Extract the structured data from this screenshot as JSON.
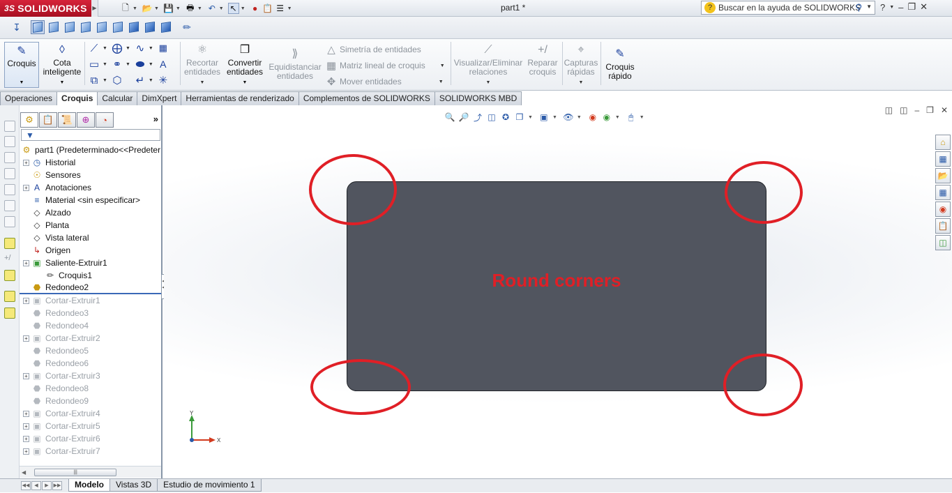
{
  "app": {
    "logo_ds": "3S",
    "logo_name": "SOLIDWORKS",
    "document_title": "part1 *"
  },
  "help": {
    "search_placeholder": "Buscar en la ayuda de SOLIDWORKS"
  },
  "command_manager": {
    "croquis": "Croquis",
    "cota_line1": "Cota",
    "cota_line2": "inteligente",
    "recortar_1": "Recortar",
    "recortar_2": "entidades",
    "convertir_1": "Convertir",
    "convertir_2": "entidades",
    "equidistanciar_1": "Equidistanciar",
    "equidistanciar_2": "entidades",
    "simetria": "Simetría de entidades",
    "matriz": "Matriz lineal de croquis",
    "mover": "Mover entidades",
    "visualizar_1": "Visualizar/Eliminar",
    "visualizar_2": "relaciones",
    "reparar_1": "Reparar",
    "reparar_2": "croquis",
    "capturas_1": "Capturas",
    "capturas_2": "rápidas",
    "croquis_rapido_1": "Croquis",
    "croquis_rapido_2": "rápido"
  },
  "tabs": [
    "Operaciones",
    "Croquis",
    "Calcular",
    "DimXpert",
    "Herramientas de renderizado",
    "Complementos de SOLIDWORKS",
    "SOLIDWORKS MBD"
  ],
  "active_tab": "Croquis",
  "feature_tree": [
    {
      "label": "part1  (Predeterminado<<Predeter",
      "icon": "part-icon",
      "level": 0,
      "expand": false,
      "state": "normal"
    },
    {
      "label": "Historial",
      "icon": "history-icon",
      "level": 1,
      "expand": true,
      "state": "normal"
    },
    {
      "label": "Sensores",
      "icon": "sensor-icon",
      "level": 1,
      "expand": false,
      "state": "normal"
    },
    {
      "label": "Anotaciones",
      "icon": "annotation-icon",
      "level": 1,
      "expand": true,
      "state": "normal"
    },
    {
      "label": "Material <sin especificar>",
      "icon": "material-icon",
      "level": 1,
      "expand": false,
      "state": "normal"
    },
    {
      "label": "Alzado",
      "icon": "plane-icon",
      "level": 1,
      "expand": false,
      "state": "normal"
    },
    {
      "label": "Planta",
      "icon": "plane-icon",
      "level": 1,
      "expand": false,
      "state": "normal"
    },
    {
      "label": "Vista lateral",
      "icon": "plane-icon",
      "level": 1,
      "expand": false,
      "state": "normal"
    },
    {
      "label": "Origen",
      "icon": "origin-icon",
      "level": 1,
      "expand": false,
      "state": "normal"
    },
    {
      "label": "Saliente-Extruir1",
      "icon": "extrude-icon",
      "level": 1,
      "expand": true,
      "state": "normal"
    },
    {
      "label": "Croquis1",
      "icon": "sketch-icon",
      "level": 2,
      "expand": false,
      "state": "normal"
    },
    {
      "label": "Redondeo2",
      "icon": "fillet-icon",
      "level": 1,
      "expand": false,
      "state": "rollback"
    },
    {
      "label": "Cortar-Extruir1",
      "icon": "cut-icon",
      "level": 1,
      "expand": true,
      "state": "gray"
    },
    {
      "label": "Redondeo3",
      "icon": "fillet-icon",
      "level": 1,
      "expand": false,
      "state": "gray"
    },
    {
      "label": "Redondeo4",
      "icon": "fillet-icon",
      "level": 1,
      "expand": false,
      "state": "gray"
    },
    {
      "label": "Cortar-Extruir2",
      "icon": "cut-icon",
      "level": 1,
      "expand": true,
      "state": "gray"
    },
    {
      "label": "Redondeo5",
      "icon": "fillet-icon",
      "level": 1,
      "expand": false,
      "state": "gray"
    },
    {
      "label": "Redondeo6",
      "icon": "fillet-icon",
      "level": 1,
      "expand": false,
      "state": "gray"
    },
    {
      "label": "Cortar-Extruir3",
      "icon": "cut-icon",
      "level": 1,
      "expand": true,
      "state": "gray"
    },
    {
      "label": "Redondeo8",
      "icon": "fillet-icon",
      "level": 1,
      "expand": false,
      "state": "gray"
    },
    {
      "label": "Redondeo9",
      "icon": "fillet-icon",
      "level": 1,
      "expand": false,
      "state": "gray"
    },
    {
      "label": "Cortar-Extruir4",
      "icon": "cut-icon",
      "level": 1,
      "expand": true,
      "state": "gray"
    },
    {
      "label": "Cortar-Extruir5",
      "icon": "cut-icon",
      "level": 1,
      "expand": true,
      "state": "gray"
    },
    {
      "label": "Cortar-Extruir6",
      "icon": "cut-icon",
      "level": 1,
      "expand": true,
      "state": "gray"
    },
    {
      "label": "Cortar-Extruir7",
      "icon": "cut-icon",
      "level": 1,
      "expand": true,
      "state": "gray"
    }
  ],
  "graphics": {
    "annotation": "Round corners",
    "annotation_color": "#e01f26",
    "part_color": "#51555f",
    "axis_x": "X",
    "axis_y": "Y"
  },
  "bottom_tabs": [
    "Modelo",
    "Vistas 3D",
    "Estudio de movimiento 1"
  ],
  "active_bottom_tab": "Modelo"
}
